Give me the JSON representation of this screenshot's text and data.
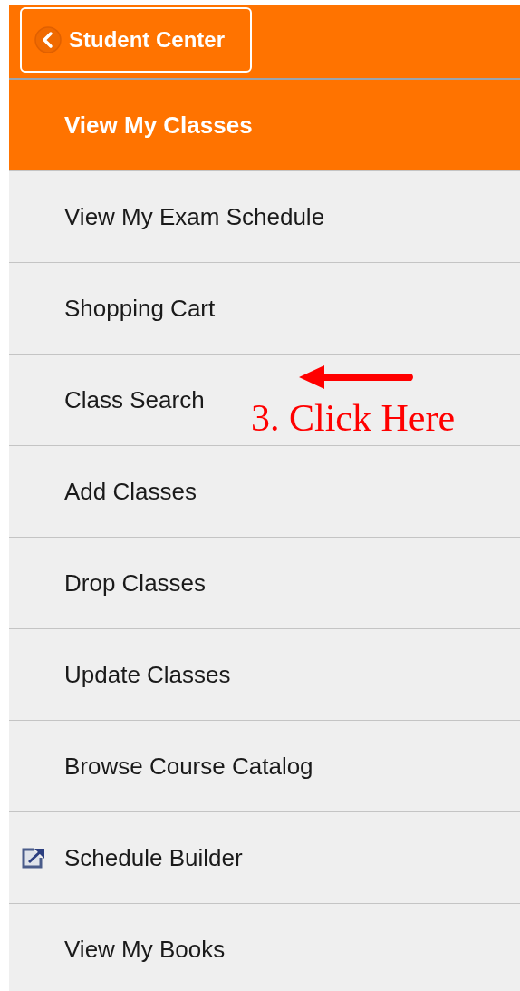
{
  "header": {
    "back_button": {
      "label": "Student Center"
    }
  },
  "menu": [
    {
      "label": "View My Classes",
      "kind": "plain",
      "selected": true
    },
    {
      "label": "View My Exam Schedule",
      "kind": "plain",
      "selected": false
    },
    {
      "label": "Shopping Cart",
      "kind": "plain",
      "selected": false
    },
    {
      "label": "Class Search",
      "kind": "plain",
      "selected": false,
      "annotation": "3. Click Here"
    },
    {
      "label": "Add Classes",
      "kind": "plain",
      "selected": false
    },
    {
      "label": "Drop Classes",
      "kind": "plain",
      "selected": false
    },
    {
      "label": "Update Classes",
      "kind": "plain",
      "selected": false
    },
    {
      "label": "Browse Course Catalog",
      "kind": "plain",
      "selected": false
    },
    {
      "label": "Schedule Builder",
      "kind": "external",
      "selected": false
    },
    {
      "label": "View My Books",
      "kind": "plain",
      "selected": false
    }
  ]
}
